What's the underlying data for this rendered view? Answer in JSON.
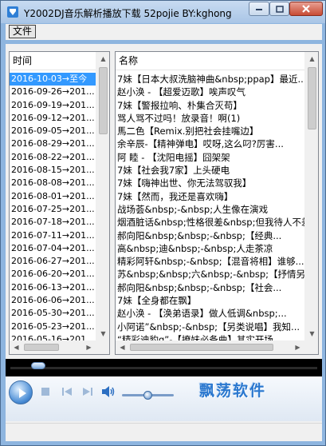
{
  "window": {
    "title": "Y2002DJ音乐解析播放下载 52pojie BY:kghong"
  },
  "menu": {
    "file_label": "文件"
  },
  "time_list": {
    "header": "时间",
    "items": [
      "2016-10-03→至今",
      "2016-09-26→201...",
      "2016-09-19→201...",
      "2016-09-12→201...",
      "2016-09-05→201...",
      "2016-08-29→201...",
      "2016-08-22→201...",
      "2016-08-15→201...",
      "2016-08-08→201...",
      "2016-08-01→201...",
      "2016-07-25→201...",
      "2016-07-18→201...",
      "2016-07-11→201...",
      "2016-07-04→201...",
      "2016-06-27→201...",
      "2016-06-20→201...",
      "2016-06-13→201...",
      "2016-06-06→201...",
      "2016-05-30→201...",
      "2016-05-23→201...",
      "2016-05-16→201..."
    ],
    "selected_index": 0
  },
  "name_list": {
    "header": "名称",
    "items": [
      "7妹【日本大叔洗脑神曲&nbsp;ppap】最近...",
      "赵小涣  - 【超爱迈歌】唉声叹气",
      "7妹【警报拉响、朴集合灭苟】",
      "骂人骂不过吗！放录音！啊(1)",
      "馬二色【Remix.别把社会挂嘴边】",
      "余辛辰-【精神弹电】哎呀,这么叼?厉害...",
      "阿  睦  - 【沈阳电摇】囧架架",
      "7妹【社会我7家】上头硬电",
      "7妹【嗨神出世、你无法驾驭我】",
      "7妹【然而，我还是喜欢嗨】",
      "战场荟&nbsp;-&nbsp;人生像在演戏",
      "烟酒脏话&nbsp;性格很差&nbsp;但我待人不差",
      "郝向阳&nbsp;&nbsp;-&nbsp;【经典...",
      "高&nbsp;迪&nbsp;-&nbsp;人走茶凉",
      "精彩阿轩&nbsp;-&nbsp;【混音将相】谁够...",
      "苏&nbsp;&nbsp;六&nbsp;-&nbsp;【抒情另...",
      "郝向阳&nbsp;&nbsp;-&nbsp;【社会...",
      "7妹【全身都在飘】",
      "赵小涣 - 【涣弟语录】做人低调&nbsp;...",
      "小阿诺”&nbsp;-&nbsp;【另类说唱】我知...",
      "“精彩迪豹g”-【撩妹必备曲】其实开场..."
    ]
  },
  "player": {
    "logo_text": "飘荡软件"
  }
}
